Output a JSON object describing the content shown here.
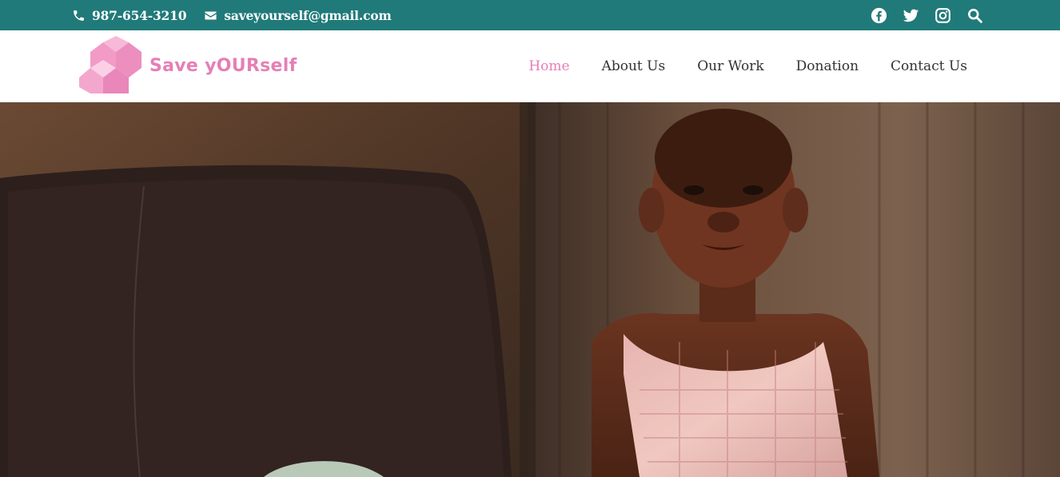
{
  "topbar": {
    "phone": "987-654-3210",
    "email": "saveyourself@gmail.com",
    "social": [
      "facebook-icon",
      "twitter-icon",
      "instagram-icon",
      "search-icon"
    ]
  },
  "brand": {
    "name": "Save yOURself",
    "color": "#e57fb6"
  },
  "nav": {
    "items": [
      "Home",
      "About Us",
      "Our Work",
      "Donation",
      "Contact Us"
    ],
    "active": "Home"
  },
  "colors": {
    "topbar": "#207a79",
    "accent": "#e57fb6"
  }
}
